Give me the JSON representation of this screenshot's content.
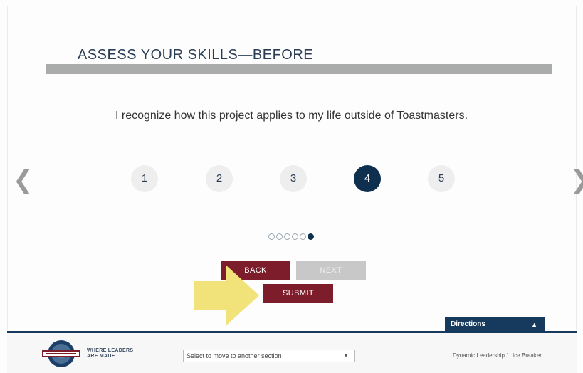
{
  "header": {
    "title": "ASSESS YOUR SKILLS—BEFORE"
  },
  "question": {
    "statement": "I recognize how this project applies to my life outside of Toastmasters."
  },
  "navigation": {
    "prev_glyph": "❮",
    "next_glyph": "❯"
  },
  "rating": {
    "options": [
      "1",
      "2",
      "3",
      "4",
      "5"
    ],
    "selected": "4"
  },
  "pagination": {
    "total": 6,
    "current": 6
  },
  "buttons": {
    "back": "BACK",
    "next": "NEXT",
    "submit": "SUBMIT"
  },
  "directions": {
    "label": "Directions",
    "caret": "▲"
  },
  "footer": {
    "tagline_line1": "WHERE LEADERS",
    "tagline_line2": "ARE MADE",
    "section_select_value": "Select to move to another section",
    "section_select_caret": "▼",
    "course_title": "Dynamic Leadership 1: Ice Breaker"
  },
  "colors": {
    "navy": "#0f2f4f",
    "maroon": "#7d1d2c",
    "pointer_yellow": "#f1e27a",
    "title_bar_gray": "#a9acab"
  }
}
